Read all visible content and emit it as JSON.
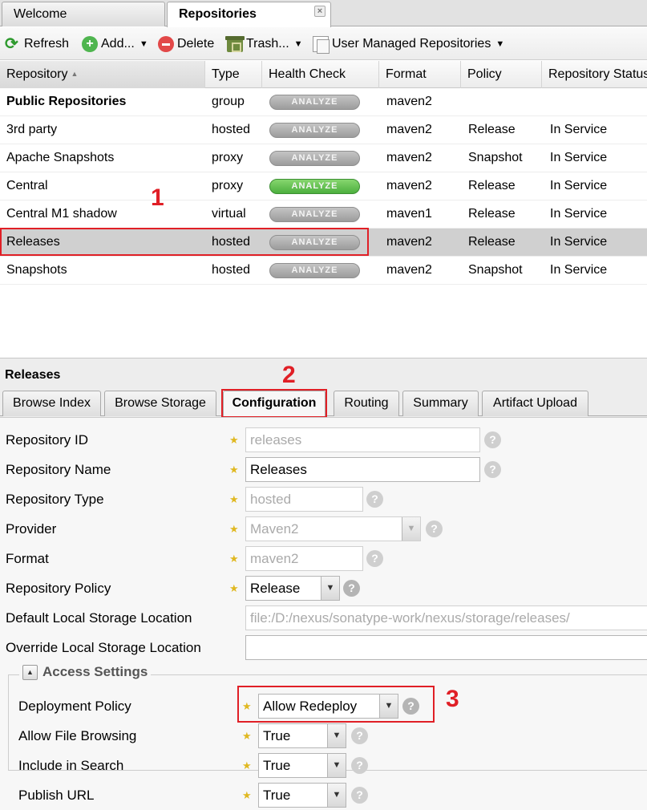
{
  "tabs": [
    {
      "label": "Welcome",
      "active": false
    },
    {
      "label": "Repositories",
      "active": true
    }
  ],
  "toolbar": {
    "refresh": "Refresh",
    "add": "Add...",
    "delete": "Delete",
    "trash": "Trash...",
    "user_managed": "User Managed Repositories"
  },
  "grid": {
    "columns": [
      "Repository",
      "Type",
      "Health Check",
      "Format",
      "Policy",
      "Repository Status"
    ],
    "analyze_label": "ANALYZE",
    "rows": [
      {
        "repository": "Public Repositories",
        "type": "group",
        "format": "maven2",
        "policy": "",
        "status": "",
        "bold": true,
        "health": "gray"
      },
      {
        "repository": "3rd party",
        "type": "hosted",
        "format": "maven2",
        "policy": "Release",
        "status": "In Service",
        "health": "gray"
      },
      {
        "repository": "Apache Snapshots",
        "type": "proxy",
        "format": "maven2",
        "policy": "Snapshot",
        "status": "In Service",
        "health": "gray"
      },
      {
        "repository": "Central",
        "type": "proxy",
        "format": "maven2",
        "policy": "Release",
        "status": "In Service",
        "health": "green"
      },
      {
        "repository": "Central M1 shadow",
        "type": "virtual",
        "format": "maven1",
        "policy": "Release",
        "status": "In Service",
        "health": "gray"
      },
      {
        "repository": "Releases",
        "type": "hosted",
        "format": "maven2",
        "policy": "Release",
        "status": "In Service",
        "health": "gray",
        "selected": true
      },
      {
        "repository": "Snapshots",
        "type": "hosted",
        "format": "maven2",
        "policy": "Snapshot",
        "status": "In Service",
        "health": "gray"
      }
    ]
  },
  "callouts": {
    "one": "1",
    "two": "2",
    "three": "3"
  },
  "detail": {
    "title": "Releases",
    "tabs": [
      "Browse Index",
      "Browse Storage",
      "Configuration",
      "Routing",
      "Summary",
      "Artifact Upload"
    ],
    "active_tab": "Configuration",
    "fields": {
      "repository_id": {
        "label": "Repository ID",
        "value": "releases"
      },
      "repository_name": {
        "label": "Repository Name",
        "value": "Releases"
      },
      "repository_type": {
        "label": "Repository Type",
        "value": "hosted"
      },
      "provider": {
        "label": "Provider",
        "value": "Maven2"
      },
      "format": {
        "label": "Format",
        "value": "maven2"
      },
      "repository_policy": {
        "label": "Repository Policy",
        "value": "Release"
      },
      "default_storage": {
        "label": "Default Local Storage Location",
        "value": "file:/D:/nexus/sonatype-work/nexus/storage/releases/"
      },
      "override_storage": {
        "label": "Override Local Storage Location",
        "value": ""
      }
    },
    "access_settings": {
      "legend": "Access Settings",
      "deployment_policy": {
        "label": "Deployment Policy",
        "value": "Allow Redeploy"
      },
      "allow_file_browsing": {
        "label": "Allow File Browsing",
        "value": "True"
      },
      "include_in_search": {
        "label": "Include in Search",
        "value": "True"
      },
      "publish_url": {
        "label": "Publish URL",
        "value": "True"
      }
    }
  },
  "colors": {
    "annotation_red": "#e01f26",
    "analyze_green": "#4caf3e",
    "analyze_gray": "#a8a8a8",
    "star": "#e0b820"
  },
  "icons": [
    "refresh-icon",
    "add-icon",
    "delete-icon",
    "trash-icon",
    "repositories-icon",
    "help-icon",
    "required-star-icon",
    "collapse-icon",
    "close-icon",
    "sort-asc-icon",
    "chevron-down-icon"
  ]
}
